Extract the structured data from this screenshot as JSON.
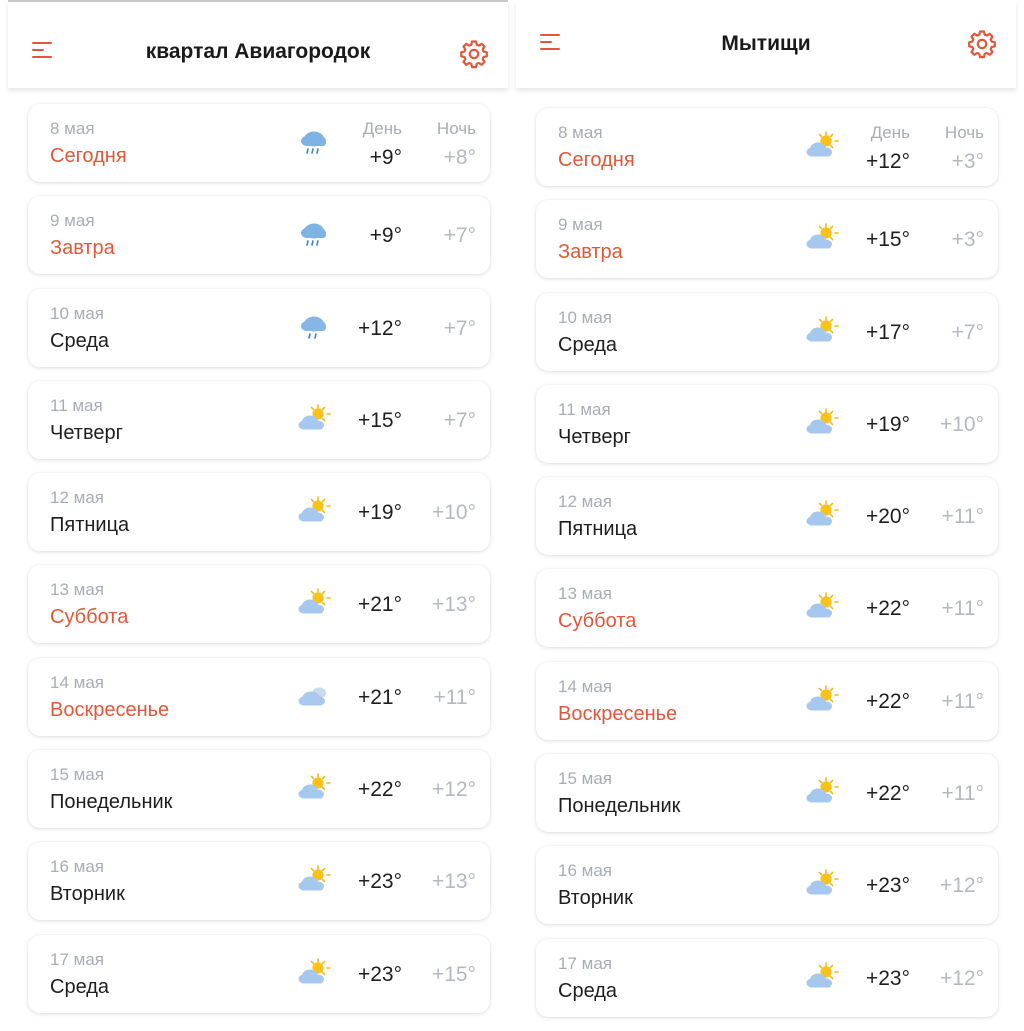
{
  "colors": {
    "accent": "#e2573a",
    "muted": "#a8adb4",
    "text": "#1e1e1e"
  },
  "left": {
    "title": "квартал Авиагородок",
    "menu_icon": "hamburger-menu-icon",
    "settings_icon": "gear-icon",
    "header_day": "День",
    "header_night": "Ночь",
    "days": [
      {
        "date": "8 мая",
        "name": "Сегодня",
        "highlight": true,
        "icon": "rain-cloud-icon",
        "day": "+9°",
        "night": "+8°"
      },
      {
        "date": "9 мая",
        "name": "Завтра",
        "highlight": true,
        "icon": "rain-cloud-icon",
        "day": "+9°",
        "night": "+7°"
      },
      {
        "date": "10 мая",
        "name": "Среда",
        "highlight": false,
        "icon": "light-rain-cloud-icon",
        "day": "+12°",
        "night": "+7°"
      },
      {
        "date": "11 мая",
        "name": "Четверг",
        "highlight": false,
        "icon": "partly-cloudy-icon",
        "day": "+15°",
        "night": "+7°"
      },
      {
        "date": "12 мая",
        "name": "Пятница",
        "highlight": false,
        "icon": "partly-cloudy-icon",
        "day": "+19°",
        "night": "+10°"
      },
      {
        "date": "13 мая",
        "name": "Суббота",
        "highlight": true,
        "icon": "partly-cloudy-icon",
        "day": "+21°",
        "night": "+13°"
      },
      {
        "date": "14 мая",
        "name": "Воскресенье",
        "highlight": true,
        "icon": "cloudy-icon",
        "day": "+21°",
        "night": "+11°"
      },
      {
        "date": "15 мая",
        "name": "Понедельник",
        "highlight": false,
        "icon": "partly-cloudy-icon",
        "day": "+22°",
        "night": "+12°"
      },
      {
        "date": "16 мая",
        "name": "Вторник",
        "highlight": false,
        "icon": "partly-cloudy-icon",
        "day": "+23°",
        "night": "+13°"
      },
      {
        "date": "17 мая",
        "name": "Среда",
        "highlight": false,
        "icon": "partly-cloudy-icon",
        "day": "+23°",
        "night": "+15°"
      }
    ]
  },
  "right": {
    "title": "Мытищи",
    "menu_icon": "hamburger-menu-icon",
    "settings_icon": "gear-icon",
    "header_day": "День",
    "header_night": "Ночь",
    "days": [
      {
        "date": "8 мая",
        "name": "Сегодня",
        "highlight": true,
        "icon": "partly-cloudy-icon",
        "day": "+12°",
        "night": "+3°"
      },
      {
        "date": "9 мая",
        "name": "Завтра",
        "highlight": true,
        "icon": "partly-cloudy-icon",
        "day": "+15°",
        "night": "+3°"
      },
      {
        "date": "10 мая",
        "name": "Среда",
        "highlight": false,
        "icon": "partly-cloudy-icon",
        "day": "+17°",
        "night": "+7°"
      },
      {
        "date": "11 мая",
        "name": "Четверг",
        "highlight": false,
        "icon": "partly-cloudy-icon",
        "day": "+19°",
        "night": "+10°"
      },
      {
        "date": "12 мая",
        "name": "Пятница",
        "highlight": false,
        "icon": "partly-cloudy-icon",
        "day": "+20°",
        "night": "+11°"
      },
      {
        "date": "13 мая",
        "name": "Суббота",
        "highlight": true,
        "icon": "partly-cloudy-icon",
        "day": "+22°",
        "night": "+11°"
      },
      {
        "date": "14 мая",
        "name": "Воскресенье",
        "highlight": true,
        "icon": "partly-cloudy-icon",
        "day": "+22°",
        "night": "+11°"
      },
      {
        "date": "15 мая",
        "name": "Понедельник",
        "highlight": false,
        "icon": "partly-cloudy-icon",
        "day": "+22°",
        "night": "+11°"
      },
      {
        "date": "16 мая",
        "name": "Вторник",
        "highlight": false,
        "icon": "partly-cloudy-icon",
        "day": "+23°",
        "night": "+12°"
      },
      {
        "date": "17 мая",
        "name": "Среда",
        "highlight": false,
        "icon": "partly-cloudy-icon",
        "day": "+23°",
        "night": "+12°"
      }
    ]
  }
}
